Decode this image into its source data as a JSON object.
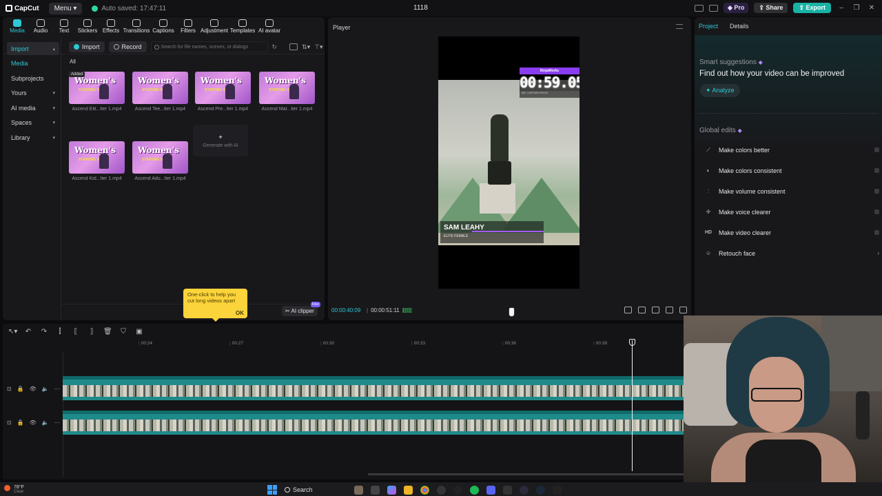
{
  "titlebar": {
    "app_name": "CapCut",
    "menu_label": "Menu",
    "autosave": "Auto saved: 17:47:11",
    "project_title": "1118",
    "pro_label": "Pro",
    "share_label": "Share",
    "export_label": "Export"
  },
  "toptools": [
    "Media",
    "Audio",
    "Text",
    "Stickers",
    "Effects",
    "Transitions",
    "Captions",
    "Filters",
    "Adjustment",
    "Templates",
    "AI avatar"
  ],
  "sidenav": {
    "import": "Import",
    "media": "Media",
    "subprojects": "Subprojects",
    "yours": "Yours",
    "ai_media": "AI media",
    "spaces": "Spaces",
    "library": "Library"
  },
  "media": {
    "import_btn": "Import",
    "record_btn": "Record",
    "search_placeholder": "Search for file names, scenes, or dialogs",
    "all_label": "All",
    "added_badge": "Added",
    "clips": [
      "Ascend Elit...fier 1.mp4",
      "Ascend Tee...fier 1.mp4",
      "Ascend Pre...fier 1.mp4",
      "Ascend Mat...fier 1.mp4",
      "Ascend Kid...fier 1.mp4",
      "Ascend Adu...fier 1.mp4"
    ],
    "thumb_title": "Women's",
    "thumb_sub": "STARTING SOON",
    "generate_ai": "Generate with AI"
  },
  "tooltip": {
    "text": "One-click to help you cut long videos apart",
    "ok": "OK"
  },
  "ai_clipper": {
    "label": "AI clipper",
    "badge": "Free"
  },
  "player": {
    "title": "Player",
    "time_current": "00:00:40:09",
    "time_total": "00:00:51:11",
    "overlay": {
      "brand": "NinjaWorks",
      "timer": "00:59.05",
      "subline": "MS. CAPTAIN ROOK",
      "name": "SAM LEAHY",
      "category": "ELITE FEMALE"
    }
  },
  "rightpanel": {
    "tab_project": "Project",
    "tab_details": "Details",
    "smart_title": "Smart suggestions",
    "improve_text": "Find out how your video can be improved",
    "analyze_label": "Analyze",
    "global_title": "Global edits",
    "edits": [
      {
        "icon": "wand-icon",
        "label": "Make colors better"
      },
      {
        "icon": "palette-icon",
        "label": "Make colors consistent"
      },
      {
        "icon": "sliders-icon",
        "label": "Make volume consistent"
      },
      {
        "icon": "sparkle-icon",
        "label": "Make voice clearer"
      },
      {
        "icon": "hd-icon",
        "label": "Make video clearer"
      },
      {
        "icon": "face-icon",
        "label": "Retouch face"
      }
    ]
  },
  "timeline": {
    "ticks": [
      "00:24",
      "00:27",
      "00:30",
      "00:33",
      "00:36",
      "00:39"
    ]
  },
  "taskbar": {
    "temp": "78°F",
    "condition": "Clear",
    "search": "Search"
  }
}
